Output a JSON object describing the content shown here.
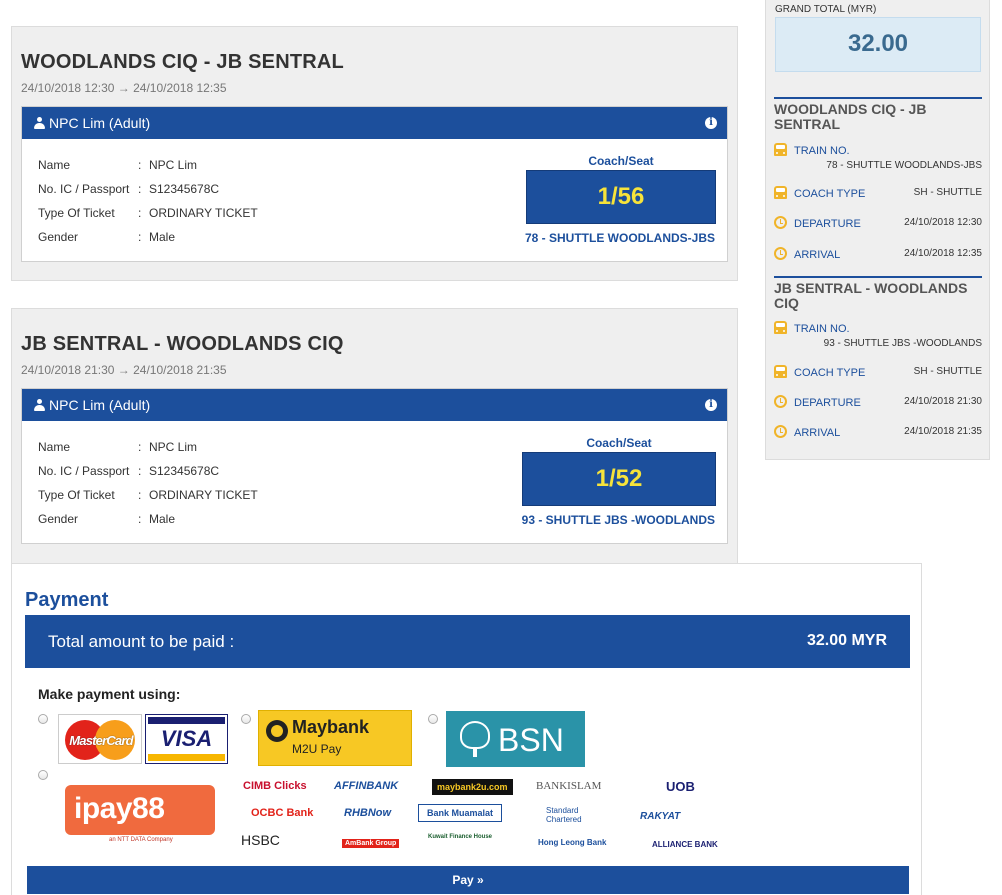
{
  "trips": [
    {
      "title": "WOODLANDS CIQ - JB SENTRAL",
      "time": "24/10/2018 12:30 → 24/10/2018 12:35",
      "passenger": {
        "header": "NPC Lim (Adult)",
        "rows": [
          {
            "label": "Name",
            "sep": ":",
            "value": "NPC Lim"
          },
          {
            "label": "No. IC / Passport",
            "sep": ":",
            "value": "S12345678C"
          },
          {
            "label": "Type Of Ticket",
            "sep": ":",
            "value": "ORDINARY TICKET"
          },
          {
            "label": "Gender",
            "sep": ":",
            "value": "Male"
          }
        ],
        "seat_caption": "Coach/Seat",
        "seat": "1/56",
        "train": "78 - SHUTTLE WOODLANDS-JBS"
      }
    },
    {
      "title": "JB SENTRAL - WOODLANDS CIQ",
      "time": "24/10/2018 21:30 → 24/10/2018 21:35",
      "passenger": {
        "header": "NPC Lim (Adult)",
        "rows": [
          {
            "label": "Name",
            "sep": ":",
            "value": "NPC Lim"
          },
          {
            "label": "No. IC / Passport",
            "sep": ":",
            "value": "S12345678C"
          },
          {
            "label": "Type Of Ticket",
            "sep": ":",
            "value": "ORDINARY TICKET"
          },
          {
            "label": "Gender",
            "sep": ":",
            "value": "Male"
          }
        ],
        "seat_caption": "Coach/Seat",
        "seat": "1/52",
        "train": "93 - SHUTTLE JBS -WOODLANDS"
      }
    }
  ],
  "summary": {
    "grand_total_label": "GRAND TOTAL (MYR)",
    "grand_total": "32.00",
    "segments": [
      {
        "title": "WOODLANDS CIQ - JB SENTRAL",
        "train_label": "TRAIN NO.",
        "train_value": "78 - SHUTTLE WOODLANDS-JBS",
        "coach_label": "COACH TYPE",
        "coach_value": "SH - SHUTTLE",
        "departure_label": "DEPARTURE",
        "departure_value": "24/10/2018 12:30",
        "arrival_label": "ARRIVAL",
        "arrival_value": "24/10/2018 12:35"
      },
      {
        "title": "JB SENTRAL - WOODLANDS CIQ",
        "train_label": "TRAIN NO.",
        "train_value": "93 - SHUTTLE JBS -WOODLANDS",
        "coach_label": "COACH TYPE",
        "coach_value": "SH - SHUTTLE",
        "departure_label": "DEPARTURE",
        "departure_value": "24/10/2018 21:30",
        "arrival_label": "ARRIVAL",
        "arrival_value": "24/10/2018 21:35"
      }
    ]
  },
  "payment": {
    "title": "Payment",
    "total_label": "Total amount to be paid :",
    "total_value": "32.00 MYR",
    "make_payment_label": "Make payment using:",
    "mastercard": "MasterCard",
    "visa": "VISA",
    "maybank": "Maybank",
    "maybank_sub": "M2U Pay",
    "bsn": "BSN",
    "ipay": "ipay88",
    "ipay_sub": "an NTT DATA Company",
    "banks": {
      "cimb": "CIMB Clicks",
      "affin": "AFFINBANK",
      "maybank2u": "maybank2u.com",
      "bankislam": "BANKISLAM",
      "uob": "UOB",
      "ocbc": "OCBC Bank",
      "rhb": "RHBNow",
      "muamalat": "Bank Muamalat",
      "stanchart": "Standard Chartered",
      "rakyat": "RAKYAT",
      "hsbc": "HSBC",
      "ambank": "AmBank Group",
      "kfh": "Kuwait Finance House",
      "hongleong": "Hong Leong Bank",
      "alliance": "ALLIANCE BANK"
    },
    "pay_button": "Pay »"
  },
  "colors": {
    "primary": "#1c4f9c",
    "seat_text": "#f7e33a",
    "icon_accent": "#f0b429",
    "panel_bg": "#efefef"
  }
}
